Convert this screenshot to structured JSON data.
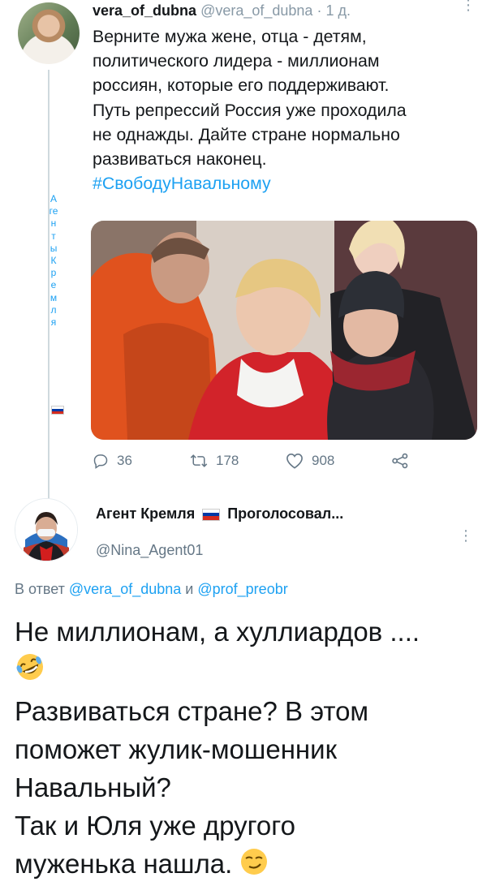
{
  "tweet": {
    "display_name": "vera_of_dubna",
    "handle": "@vera_of_dubna",
    "separator": "·",
    "time": "1 д.",
    "lines": [
      "Верните мужа жене, отца - детям,",
      "политического лидера - миллионам",
      "россиян, которые его поддерживают.",
      "Путь репрессий Россия уже проходила",
      "не однажды. Дайте стране нормально",
      "развиваться наконец."
    ],
    "hashtag": "#СвободуНавальному",
    "actions": {
      "replies": "36",
      "retweets": "178",
      "likes": "908"
    }
  },
  "thread": {
    "vertical_tag": "Агенты Кремля"
  },
  "reply": {
    "display_name": "Агент Кремля",
    "display_name_suffix": "Проголосовал...",
    "handle": "@Nina_Agent01",
    "replying_prefix": "В ответ",
    "mention1": "@vera_of_dubna",
    "conjunction": "и",
    "mention2": "@prof_preobr",
    "line1": "Не миллионам, а хуллиардов ....",
    "line2": "Развиваться стране? В этом",
    "line3": "поможет жулик-мошенник",
    "line4": "Навальный?",
    "line5": "Так и Юля уже другого",
    "line6": "муженька нашла."
  },
  "icons": {
    "reply": "reply-icon",
    "retweet": "retweet-icon",
    "like": "heart-icon",
    "share": "share-icon",
    "more": "more-icon",
    "flag": "russia-flag-icon",
    "emoji1": "rofl-emoji",
    "emoji2": "smirk-emoji"
  },
  "colors": {
    "link": "#1da1f2",
    "muted": "#657786",
    "text": "#14171a",
    "flag_white": "#ffffff",
    "flag_blue": "#0039a6",
    "flag_red": "#d52b1e"
  }
}
